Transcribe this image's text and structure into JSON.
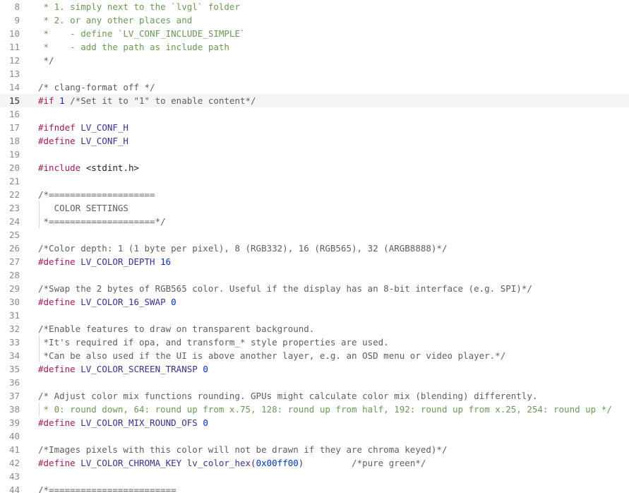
{
  "editor": {
    "current_line": 15,
    "colors": {
      "comment": "#5e5e5e",
      "doc_comment": "#6a9955",
      "directive": "#a3195b",
      "macro": "#3a2f8f",
      "number": "#0033b3",
      "line_number": "#8a8a8a",
      "current_line_bg": "#f5f5f5"
    },
    "lines": [
      {
        "n": "8",
        "tokens": [
          {
            "t": " * 1. simply next to the `lvgl` folder",
            "c": "comment-green"
          }
        ]
      },
      {
        "n": "9",
        "tokens": [
          {
            "t": " * 2. or any other places and",
            "c": "comment-green"
          }
        ]
      },
      {
        "n": "10",
        "tokens": [
          {
            "t": " *    - define `LV_CONF_INCLUDE_SIMPLE`",
            "c": "comment-green"
          }
        ]
      },
      {
        "n": "11",
        "tokens": [
          {
            "t": " *    - add the path as include path",
            "c": "comment-green"
          }
        ]
      },
      {
        "n": "12",
        "tokens": [
          {
            "t": " */",
            "c": "comment"
          }
        ]
      },
      {
        "n": "13",
        "tokens": []
      },
      {
        "n": "14",
        "tokens": [
          {
            "t": "/* clang-format off */",
            "c": "comment"
          }
        ]
      },
      {
        "n": "15",
        "tokens": [
          {
            "t": "#if",
            "c": "directive"
          },
          {
            "t": " ",
            "c": "text"
          },
          {
            "t": "1",
            "c": "number"
          },
          {
            "t": " /*Set it to \"1\" to enable content*/",
            "c": "comment"
          }
        ]
      },
      {
        "n": "16",
        "tokens": []
      },
      {
        "n": "17",
        "tokens": [
          {
            "t": "#ifndef",
            "c": "directive"
          },
          {
            "t": " LV_CONF_H",
            "c": "macro"
          }
        ]
      },
      {
        "n": "18",
        "tokens": [
          {
            "t": "#define",
            "c": "directive"
          },
          {
            "t": " LV_CONF_H",
            "c": "macro"
          }
        ]
      },
      {
        "n": "19",
        "tokens": []
      },
      {
        "n": "20",
        "tokens": [
          {
            "t": "#include",
            "c": "directive"
          },
          {
            "t": " <stdint.h>",
            "c": "text"
          }
        ]
      },
      {
        "n": "21",
        "tokens": []
      },
      {
        "n": "22",
        "tokens": [
          {
            "t": "/*====================",
            "c": "comment"
          }
        ]
      },
      {
        "n": "23",
        "guide": true,
        "tokens": [
          {
            "t": "   COLOR SETTINGS",
            "c": "comment"
          }
        ]
      },
      {
        "n": "24",
        "guide": true,
        "tokens": [
          {
            "t": " *====================*/",
            "c": "comment"
          }
        ]
      },
      {
        "n": "25",
        "tokens": []
      },
      {
        "n": "26",
        "tokens": [
          {
            "t": "/*Color depth: 1 (1 byte per pixel), 8 (RGB332), 16 (RGB565), 32 (ARGB8888)*/",
            "c": "comment"
          }
        ]
      },
      {
        "n": "27",
        "tokens": [
          {
            "t": "#define",
            "c": "directive"
          },
          {
            "t": " LV_COLOR_DEPTH ",
            "c": "macro"
          },
          {
            "t": "16",
            "c": "number"
          }
        ]
      },
      {
        "n": "28",
        "tokens": []
      },
      {
        "n": "29",
        "tokens": [
          {
            "t": "/*Swap the 2 bytes of RGB565 color. Useful if the display has an 8-bit interface (e.g. SPI)*/",
            "c": "comment"
          }
        ]
      },
      {
        "n": "30",
        "tokens": [
          {
            "t": "#define",
            "c": "directive"
          },
          {
            "t": " LV_COLOR_16_SWAP ",
            "c": "macro"
          },
          {
            "t": "0",
            "c": "number"
          }
        ]
      },
      {
        "n": "31",
        "tokens": []
      },
      {
        "n": "32",
        "tokens": [
          {
            "t": "/*Enable features to draw on transparent background.",
            "c": "comment"
          }
        ]
      },
      {
        "n": "33",
        "guide": true,
        "tokens": [
          {
            "t": " *It's required if opa, and transform_* style properties are used.",
            "c": "comment"
          }
        ]
      },
      {
        "n": "34",
        "guide": true,
        "tokens": [
          {
            "t": " *Can be also used if the UI is above another layer, e.g. an OSD menu or video player.*/",
            "c": "comment"
          }
        ]
      },
      {
        "n": "35",
        "tokens": [
          {
            "t": "#define",
            "c": "directive"
          },
          {
            "t": " LV_COLOR_SCREEN_TRANSP ",
            "c": "macro"
          },
          {
            "t": "0",
            "c": "number"
          }
        ]
      },
      {
        "n": "36",
        "tokens": []
      },
      {
        "n": "37",
        "tokens": [
          {
            "t": "/* Adjust color mix functions rounding. GPUs might calculate color mix (blending) differently.",
            "c": "comment"
          }
        ]
      },
      {
        "n": "38",
        "guide": true,
        "tokens": [
          {
            "t": " * 0: round down, 64: round up from x.75, 128: round up from half, 192: round up from x.25, 254: round up */",
            "c": "comment-green"
          }
        ]
      },
      {
        "n": "39",
        "tokens": [
          {
            "t": "#define",
            "c": "directive"
          },
          {
            "t": " LV_COLOR_MIX_ROUND_OFS ",
            "c": "macro"
          },
          {
            "t": "0",
            "c": "number"
          }
        ]
      },
      {
        "n": "40",
        "tokens": []
      },
      {
        "n": "41",
        "tokens": [
          {
            "t": "/*Images pixels with this color will not be drawn if they are chroma keyed)*/",
            "c": "comment"
          }
        ]
      },
      {
        "n": "42",
        "tokens": [
          {
            "t": "#define",
            "c": "directive"
          },
          {
            "t": " LV_COLOR_CHROMA_KEY lv_color_hex(",
            "c": "macro"
          },
          {
            "t": "0x00ff00",
            "c": "number"
          },
          {
            "t": ")         ",
            "c": "macro"
          },
          {
            "t": "/*pure green*/",
            "c": "comment"
          }
        ]
      },
      {
        "n": "43",
        "tokens": []
      },
      {
        "n": "44",
        "tokens": [
          {
            "t": "/*========================",
            "c": "comment"
          }
        ]
      }
    ]
  }
}
